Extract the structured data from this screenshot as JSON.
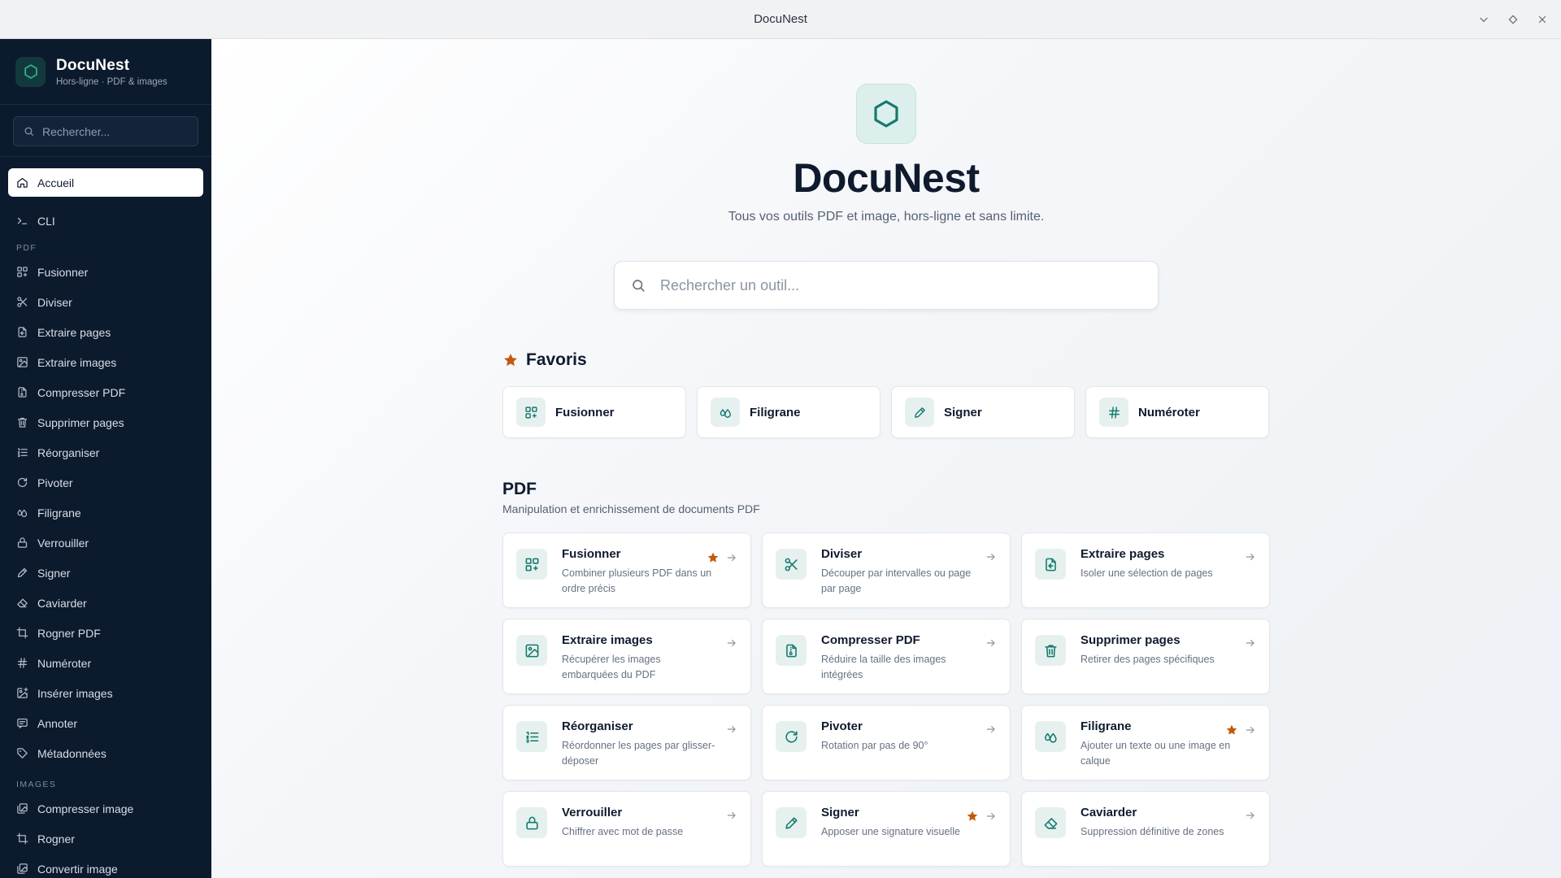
{
  "window": {
    "title": "DocuNest"
  },
  "sidebar": {
    "brand_name": "DocuNest",
    "brand_sub": "Hors-ligne · PDF & images",
    "search_placeholder": "Rechercher...",
    "home": "Accueil",
    "cli": "CLI",
    "pdf_section": "PDF",
    "pdf_items": [
      "Fusionner",
      "Diviser",
      "Extraire pages",
      "Extraire images",
      "Compresser PDF",
      "Supprimer pages",
      "Réorganiser",
      "Pivoter",
      "Filigrane",
      "Verrouiller",
      "Signer",
      "Caviarder",
      "Rogner PDF",
      "Numéroter",
      "Insérer images",
      "Annoter",
      "Métadonnées"
    ],
    "images_section": "IMAGES",
    "image_items": [
      "Compresser image",
      "Rogner",
      "Convertir image"
    ]
  },
  "hero": {
    "title": "DocuNest",
    "subtitle": "Tous vos outils PDF et image, hors-ligne et sans limite.",
    "search_placeholder": "Rechercher un outil..."
  },
  "favorites": {
    "title": "Favoris",
    "items": [
      "Fusionner",
      "Filigrane",
      "Signer",
      "Numéroter"
    ]
  },
  "pdf_section": {
    "title": "PDF",
    "subtitle": "Manipulation et enrichissement de documents PDF",
    "tools": [
      {
        "name": "Fusionner",
        "desc": "Combiner plusieurs PDF dans un ordre précis",
        "fav": true
      },
      {
        "name": "Diviser",
        "desc": "Découper par intervalles ou page par page",
        "fav": false
      },
      {
        "name": "Extraire pages",
        "desc": "Isoler une sélection de pages",
        "fav": false
      },
      {
        "name": "Extraire images",
        "desc": "Récupérer les images embarquées du PDF",
        "fav": false
      },
      {
        "name": "Compresser PDF",
        "desc": "Réduire la taille des images intégrées",
        "fav": false
      },
      {
        "name": "Supprimer pages",
        "desc": "Retirer des pages spécifiques",
        "fav": false
      },
      {
        "name": "Réorganiser",
        "desc": "Réordonner les pages par glisser-déposer",
        "fav": false
      },
      {
        "name": "Pivoter",
        "desc": "Rotation par pas de 90°",
        "fav": false
      },
      {
        "name": "Filigrane",
        "desc": "Ajouter un texte ou une image en calque",
        "fav": true
      },
      {
        "name": "Verrouiller",
        "desc": "Chiffrer avec mot de passe",
        "fav": false
      },
      {
        "name": "Signer",
        "desc": "Apposer une signature visuelle",
        "fav": true
      },
      {
        "name": "Caviarder",
        "desc": "Suppression définitive de zones",
        "fav": false
      }
    ]
  },
  "colors": {
    "sidebar_bg": "#0c1a2e",
    "accent": "#147a6e",
    "star": "#c25a0d"
  }
}
